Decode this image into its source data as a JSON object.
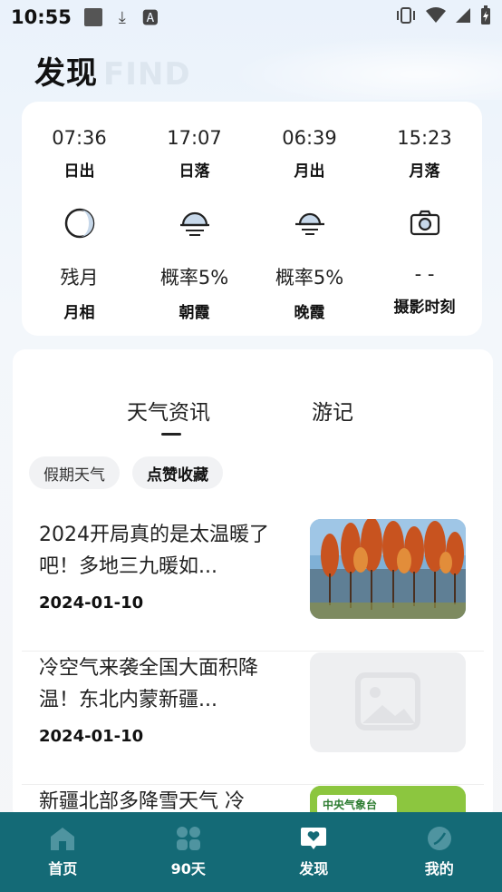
{
  "status_bar": {
    "time": "10:55"
  },
  "header": {
    "title": "发现",
    "subtitle": "FIND"
  },
  "sun_moon": {
    "times": [
      {
        "value": "07:36",
        "label": "日出"
      },
      {
        "value": "17:07",
        "label": "日落"
      },
      {
        "value": "06:39",
        "label": "月出"
      },
      {
        "value": "15:23",
        "label": "月落"
      }
    ],
    "conditions": [
      {
        "icon": "moon-phase-icon",
        "value": "残月",
        "label": "月相"
      },
      {
        "icon": "sunrise-icon",
        "value": "概率5%",
        "label": "朝霞"
      },
      {
        "icon": "sunset-icon",
        "value": "概率5%",
        "label": "晚霞"
      },
      {
        "icon": "camera-icon",
        "value": "- -",
        "label": "摄影时刻"
      }
    ]
  },
  "news": {
    "tabs": [
      {
        "label": "天气资讯"
      },
      {
        "label": "游记"
      }
    ],
    "chips": [
      {
        "label": "假期天气"
      },
      {
        "label": "点赞收藏"
      }
    ],
    "items": [
      {
        "title": "2024开局真的是太温暖了吧！多地三九暖如...",
        "date": "2024-01-10"
      },
      {
        "title": "冷空气来袭全国大面积降温！东北内蒙新疆...",
        "date": "2024-01-10"
      },
      {
        "title": "新疆北部多降雪天气 冷",
        "date": "",
        "thumb_text": "中央气象台"
      }
    ]
  },
  "bottom_nav": [
    {
      "label": "首页",
      "icon": "home-icon"
    },
    {
      "label": "90天",
      "icon": "grid-icon"
    },
    {
      "label": "发现",
      "icon": "discover-icon"
    },
    {
      "label": "我的",
      "icon": "profile-icon"
    }
  ],
  "colors": {
    "nav_bg": "#146a76",
    "nav_icon": "#4f94a0",
    "nav_icon_active": "#ffffff"
  }
}
